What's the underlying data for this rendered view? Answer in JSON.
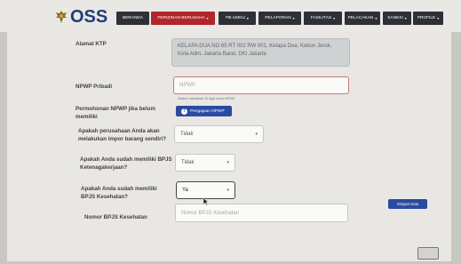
{
  "logo": {
    "text": "OSS"
  },
  "nav": {
    "items": [
      {
        "label": "BERANDA",
        "caret": ""
      },
      {
        "label": "PERIZINAN BERUSAHA",
        "caret": "▾"
      },
      {
        "label": "PB UMKU",
        "caret": "▾"
      },
      {
        "label": "PELAPORAN",
        "caret": "▾"
      },
      {
        "label": "FASILITAS",
        "caret": "▾"
      },
      {
        "label": "PELACAKAN",
        "caret": "▾"
      },
      {
        "label": "SANKSI",
        "caret": "▾"
      },
      {
        "label": "PROFILE",
        "caret": "▾"
      }
    ]
  },
  "form": {
    "alamat_ktp": {
      "label": "Alamat KTP",
      "value": "KELAPA DUA NO 65 RT 002 RW 001, Kelapa Dua, Kebon Jeruk, Kota Adm. Jakarta Barat, DKI Jakarta"
    },
    "npwp": {
      "label": "NPWP Pribadi",
      "placeholder": "NPWP",
      "hint": "Silakan masukkan 15 digit nomor NPWP"
    },
    "permohonan_npwp": {
      "label": "Permohonan NPWP jika belum memiliki",
      "button": "Pengajuan NPWP"
    },
    "impor": {
      "label": "Apakah perusahaan Anda akan melakukan impor barang sendiri?",
      "selected": "Tidak"
    },
    "bpjs_ketenagakerjaan": {
      "label": "Apakah Anda sudah memiliki BPJS Ketenagakerjaan?",
      "selected": "Tidak"
    },
    "bpjs_kesehatan": {
      "label": "Apakah Anda sudah memiliki BPJS Kesehatan?",
      "selected": "Ya"
    },
    "nomor_bpjs": {
      "label": "Nomor BPJS Kesehatan",
      "placeholder": "Nomor BPJS Kesehatan"
    },
    "save_label": "Simpan Data"
  },
  "colors": {
    "nav_dark": "#2d3136",
    "nav_active": "#b0262a",
    "primary": "#2b4aa1",
    "logo": "#1f3d7a"
  },
  "icons": {
    "logo": "garuda-emblem-icon",
    "dropdown": "chevron-down-icon",
    "help": "question-circle-icon",
    "pointer": "mouse-cursor-icon"
  }
}
